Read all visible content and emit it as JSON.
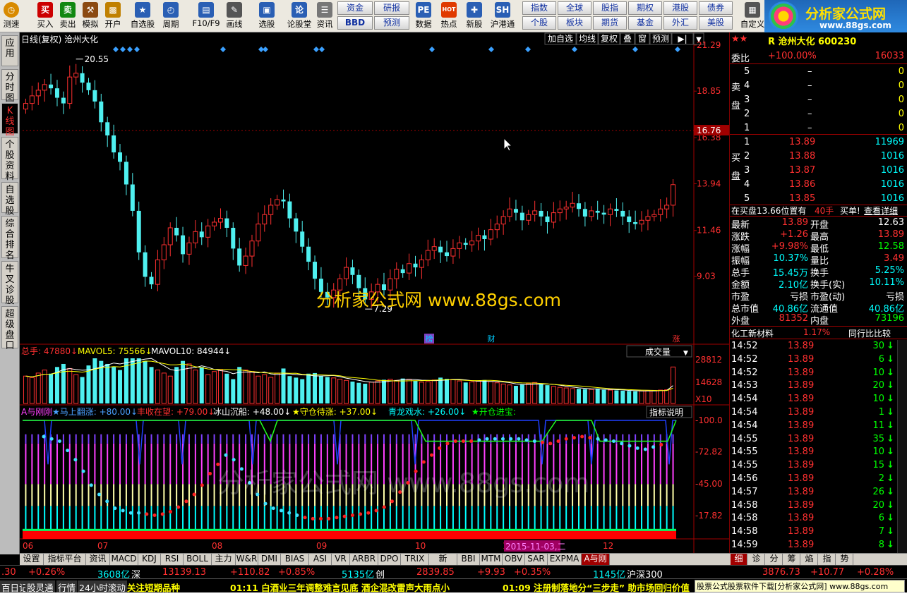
{
  "toolbar": {
    "buttons": [
      {
        "label": "测速",
        "icon": "clock-icon",
        "color": "#d88a00"
      },
      {
        "label": "买入",
        "icon": "buy-icon",
        "color": "#cc0000",
        "glyph": "买"
      },
      {
        "label": "卖出",
        "icon": "sell-icon",
        "color": "#118811",
        "glyph": "卖"
      },
      {
        "label": "模拟",
        "icon": "hammer-icon",
        "color": "#8b4a12"
      },
      {
        "label": "开户",
        "icon": "lock-icon",
        "color": "#c08000"
      },
      {
        "label": "自选股",
        "icon": "star-icon",
        "color": "#2a5fb4"
      },
      {
        "label": "周期",
        "icon": "period-icon",
        "color": "#2a5fb4"
      },
      {
        "label": "F10/F9",
        "icon": "f10-icon",
        "color": "#2a5fb4"
      },
      {
        "label": "画线",
        "icon": "pen-icon",
        "color": "#555"
      },
      {
        "label": "选股",
        "icon": "monitor-icon",
        "color": "#2a5fb4"
      },
      {
        "label": "论股堂",
        "icon": "forum-icon",
        "color": "#2a5fb4",
        "glyph": "论"
      },
      {
        "label": "资讯",
        "icon": "doc-icon",
        "color": "#777"
      },
      {
        "label": "数据",
        "icon": "pe-icon",
        "color": "#2a5fb4",
        "glyph": "PE"
      },
      {
        "label": "热点",
        "icon": "hot-icon",
        "color": "#e03a00",
        "glyph": "HOT"
      },
      {
        "label": "新股",
        "icon": "newstock-icon",
        "color": "#2a5fb4"
      },
      {
        "label": "沪港通",
        "icon": "shhk-icon",
        "color": "#2a5fb4",
        "glyph": "SH"
      },
      {
        "label": "自定义",
        "icon": "custom-icon",
        "color": "#555"
      }
    ],
    "grid_buttons": [
      "资金",
      "研报",
      "BBD",
      "预测",
      "指数",
      "全球",
      "股指",
      "期权",
      "港股",
      "债券",
      "个股",
      "板块",
      "期货",
      "基金",
      "外汇",
      "美股"
    ]
  },
  "logo": {
    "name": "分析家公式网",
    "url": "www.88gs.com"
  },
  "left_tabs": [
    "应用",
    "分时图",
    "K线图",
    "个股资料",
    "自选股",
    "综合排名",
    "牛叉诊股",
    "超级盘口"
  ],
  "chart_header": {
    "title": "日线(复权) 沧州大化",
    "buttons": [
      "加自选",
      "均线",
      "复权",
      "叠",
      "窗",
      "预测",
      "▶|"
    ],
    "high_label": "20.55",
    "low_label": "7.29",
    "current_price": "16.76",
    "events": [
      "榜",
      "财",
      "涨"
    ],
    "watermark": "分析家公式网 www.88gs.com",
    "watermark2": "分析家公式网 www.88gs.com"
  },
  "price_axis": [
    "21.29",
    "18.85",
    "16.38",
    "13.94",
    "11.46",
    "9.03"
  ],
  "volume_header": {
    "total": "总手: 47880",
    "mavol5": "MAVOL5: 75566",
    "mavol10": "MAVOL10: 84944",
    "selector": "成交量"
  },
  "volume_axis": [
    "28812",
    "14628",
    "X10"
  ],
  "indicator_header": {
    "items": [
      {
        "text": "A与刚刚",
        "color": "#ff40ff"
      },
      {
        "text": "★马上翻涨: +80.00",
        "color": "#4aa0ff"
      },
      {
        "text": "丰收在望: +79.00",
        "color": "#ff3030"
      },
      {
        "text": "冰山沉船: +48.00",
        "color": "#ffffff"
      },
      {
        "text": "★守仓待涨: +37.00",
        "color": "#ffff00"
      },
      {
        "text": "青龙戏水: +26.00",
        "color": "#00ffff"
      },
      {
        "text": "★开仓进宝:",
        "color": "#00ff00"
      }
    ],
    "button": "指标说明"
  },
  "indicator_axis": [
    "100.0",
    "72.82",
    "45.00",
    "17.82"
  ],
  "date_axis": [
    "06",
    "07",
    "08",
    "09",
    "10",
    "11",
    "12"
  ],
  "date_highlight": "2015-11-03,二",
  "chart_data": {
    "type": "candlestick",
    "title": "日线(复权) 沧州大化",
    "ylabel": "",
    "ylim": [
      5.5,
      21.29
    ],
    "high": 20.55,
    "low": 7.29,
    "close": [
      18.2,
      18.6,
      18.9,
      19.2,
      19.0,
      18.5,
      18.2,
      19.6,
      19.8,
      19.3,
      18.9,
      18.3,
      17.2,
      16.5,
      15.6,
      15.1,
      13.9,
      12.5,
      10.3,
      9.0,
      8.6,
      9.9,
      10.7,
      11.6,
      11.2,
      10.2,
      10.8,
      11.4,
      11.1,
      11.7,
      11.9,
      12.1,
      11.6,
      10.5,
      9.6,
      10.1,
      10.9,
      11.8,
      12.3,
      12.8,
      13.1,
      13.0,
      12.1,
      11.4,
      10.6,
      9.8,
      8.9,
      8.2,
      7.9,
      8.3,
      8.9,
      9.5,
      9.1,
      8.4,
      7.8,
      8.2,
      8.6,
      8.3,
      8.9,
      9.4,
      9.2,
      9.7,
      9.5,
      9.9,
      10.4,
      10.6,
      10.3,
      10.1,
      10.5,
      10.8,
      10.7,
      10.9,
      11.2,
      11.0,
      11.5,
      11.8,
      12.2,
      12.6,
      12.4,
      12.0,
      12.3,
      12.5,
      12.2,
      11.9,
      12.4,
      12.6,
      12.7,
      12.9,
      12.6,
      12.2,
      12.5,
      12.4,
      12.3,
      12.6,
      12.5,
      12.2,
      11.9,
      11.8,
      12.0,
      12.2,
      12.3,
      12.6,
      12.8,
      13.89
    ],
    "volume": [
      9000,
      8500,
      10000,
      11000,
      9800,
      12000,
      13000,
      11500,
      9500,
      8700,
      12500,
      15000,
      14000,
      13000,
      12000,
      11000,
      17000,
      16000,
      15000,
      14000,
      12000,
      11000,
      10000,
      9000,
      12000,
      14000,
      13000,
      11000,
      12000,
      9500,
      10500,
      11000,
      9800,
      8000,
      12000,
      11000,
      10500,
      9000,
      9500,
      8600,
      10000,
      11500,
      9000,
      8500,
      8000,
      9800,
      10000,
      9000,
      8700,
      8400,
      8000,
      7600,
      7200,
      6800,
      6500,
      7000,
      7400,
      7800,
      8000,
      7600,
      8200,
      8000,
      7500,
      7000,
      7200,
      7700,
      8500,
      8100,
      7900,
      7400,
      6900,
      7100,
      7300,
      7700,
      7200,
      6800,
      6400,
      6100,
      5800,
      6200,
      6600,
      6900,
      6300,
      6000,
      5600,
      5300,
      5100,
      4900,
      4800,
      4700,
      4600,
      4900,
      4500,
      4400,
      4300,
      4200,
      4100,
      4000,
      4100,
      4200,
      4300,
      4400,
      4500,
      12000
    ],
    "series": [
      {
        "name": "MAVOL5",
        "value": 75566
      },
      {
        "name": "MAVOL10",
        "value": 84944
      }
    ],
    "indicator": {
      "马上翻涨": 80.0,
      "丰收在望": 79.0,
      "冰山沉船": 48.0,
      "守仓待涨": 37.0,
      "青龙戏水": 26.0
    }
  },
  "quote": {
    "code_name": "R 沧州大化 600230",
    "weibi_label": "委比",
    "weibi": "+100.00%",
    "weicha": "16033",
    "sell_label": "卖盘",
    "buy_label": "买盘",
    "sells": [
      {
        "n": "5",
        "p": "–",
        "v": "0"
      },
      {
        "n": "4",
        "p": "–",
        "v": "0"
      },
      {
        "n": "3",
        "p": "–",
        "v": "0"
      },
      {
        "n": "2",
        "p": "–",
        "v": "0"
      },
      {
        "n": "1",
        "p": "–",
        "v": "0"
      }
    ],
    "buys": [
      {
        "n": "1",
        "p": "13.89",
        "v": "11969"
      },
      {
        "n": "2",
        "p": "13.88",
        "v": "1016"
      },
      {
        "n": "3",
        "p": "13.87",
        "v": "1016"
      },
      {
        "n": "4",
        "p": "13.86",
        "v": "1016"
      },
      {
        "n": "5",
        "p": "13.85",
        "v": "1016"
      }
    ],
    "position_text": "在买盘13.66位置有",
    "position_vol": "40手",
    "position_action": "买单!",
    "position_link": "查看详细",
    "stats": [
      {
        "l1": "最新",
        "v1": "13.89",
        "c1": "#ff3030",
        "l2": "开盘",
        "v2": "12.63",
        "c2": "#ffffff"
      },
      {
        "l1": "涨跌",
        "v1": "+1.26",
        "c1": "#ff3030",
        "l2": "最高",
        "v2": "13.89",
        "c2": "#ff3030"
      },
      {
        "l1": "涨幅",
        "v1": "+9.98%",
        "c1": "#ff3030",
        "l2": "最低",
        "v2": "12.58",
        "c2": "#00ff00"
      },
      {
        "l1": "振幅",
        "v1": "10.37%",
        "c1": "#00ffff",
        "l2": "量比",
        "v2": "3.49",
        "c2": "#ff3030"
      },
      {
        "l1": "总手",
        "v1": "15.45万",
        "c1": "#00ffff",
        "l2": "换手",
        "v2": "5.25%",
        "c2": "#00ffff"
      },
      {
        "l1": "金额",
        "v1": "2.10亿",
        "c1": "#00ffff",
        "l2": "换手(实)",
        "v2": "10.11%",
        "c2": "#00ffff"
      },
      {
        "l1": "市盈",
        "v1": "亏损",
        "c1": "#ffffff",
        "l2": "市盈(动)",
        "v2": "亏损",
        "c2": "#ffffff"
      },
      {
        "l1": "总市值",
        "v1": "40.86亿",
        "c1": "#00ffff",
        "l2": "流通值",
        "v2": "40.86亿",
        "c2": "#00ffff"
      },
      {
        "l1": "外盘",
        "v1": "81352",
        "c1": "#ff3030",
        "l2": "内盘",
        "v2": "73196",
        "c2": "#00ff00"
      }
    ],
    "sector_name": "化工新材料",
    "sector_pct": "1.17%",
    "sector_compare": "同行比比较"
  },
  "ticks": [
    {
      "t": "14:52",
      "p": "13.89",
      "v": "30",
      "d": "↓"
    },
    {
      "t": "14:52",
      "p": "13.89",
      "v": "6",
      "d": "↓"
    },
    {
      "t": "14:52",
      "p": "13.89",
      "v": "10",
      "d": "↓"
    },
    {
      "t": "14:53",
      "p": "13.89",
      "v": "20",
      "d": "↓"
    },
    {
      "t": "14:54",
      "p": "13.89",
      "v": "10",
      "d": "↓"
    },
    {
      "t": "14:54",
      "p": "13.89",
      "v": "1",
      "d": "↓"
    },
    {
      "t": "14:54",
      "p": "13.89",
      "v": "11",
      "d": "↓"
    },
    {
      "t": "14:55",
      "p": "13.89",
      "v": "35",
      "d": "↓"
    },
    {
      "t": "14:55",
      "p": "13.89",
      "v": "10",
      "d": "↓"
    },
    {
      "t": "14:55",
      "p": "13.89",
      "v": "15",
      "d": "↓"
    },
    {
      "t": "14:56",
      "p": "13.89",
      "v": "2",
      "d": "↓"
    },
    {
      "t": "14:57",
      "p": "13.89",
      "v": "26",
      "d": "↓"
    },
    {
      "t": "14:58",
      "p": "13.89",
      "v": "20",
      "d": "↓"
    },
    {
      "t": "14:58",
      "p": "13.89",
      "v": "6",
      "d": "↓"
    },
    {
      "t": "14:58",
      "p": "13.89",
      "v": "7",
      "d": "↓"
    },
    {
      "t": "14:59",
      "p": "13.89",
      "v": "8",
      "d": "↓"
    }
  ],
  "bottom_tabs": [
    "设置",
    "指标平台",
    "资讯",
    "MACD",
    "KDJ",
    "RSI",
    "BOLL",
    "主力",
    "W&R",
    "DMI",
    "BIAS",
    "ASI",
    "VR",
    "ARBR",
    "DPO",
    "TRIX",
    "新DMA",
    "BBI",
    "MTM",
    "OBV",
    "SAR",
    "EXPMA",
    "A与刚刚"
  ],
  "right_tabs": [
    "细",
    "诊",
    "分",
    "筹",
    "焰",
    "指",
    "势"
  ],
  "status": [
    {
      "t": ".30",
      "c": "#ff3030"
    },
    {
      "t": "+0.26%",
      "c": "#ff3030"
    },
    {
      "t": "3608亿",
      "c": "#00ffff"
    },
    {
      "t": "深",
      "c": "#ffffff"
    },
    {
      "t": "13139.13",
      "c": "#ff3030"
    },
    {
      "t": "+110.82",
      "c": "#ff3030"
    },
    {
      "t": "+0.85%",
      "c": "#ff3030"
    },
    {
      "t": "5135亿",
      "c": "#00ffff"
    },
    {
      "t": "创",
      "c": "#ffffff"
    },
    {
      "t": "2839.85",
      "c": "#ff3030"
    },
    {
      "t": "+9.93",
      "c": "#ff3030"
    },
    {
      "t": "+0.35%",
      "c": "#ff3030"
    },
    {
      "t": "1145亿",
      "c": "#00ffff"
    },
    {
      "t": "沪深300",
      "c": "#ffffff"
    },
    {
      "t": "3876.73",
      "c": "#ff3030"
    },
    {
      "t": "+10.77",
      "c": "#ff3030"
    },
    {
      "t": "+0.28%",
      "c": "#ff3030"
    }
  ],
  "ticker": {
    "tabs": [
      "百日记",
      "股灵通",
      "行情",
      "24小时滚动"
    ],
    "headline": "关注短期品种",
    "news1": "01:11 白酒业三年调整难言见底 酒企混改雷声大雨点小",
    "news2": "01:09 注册制落地分“三步走” 助市场回归价值",
    "ad": "股票公式股票软件下载[分析家公式网] www.88gs.com"
  }
}
